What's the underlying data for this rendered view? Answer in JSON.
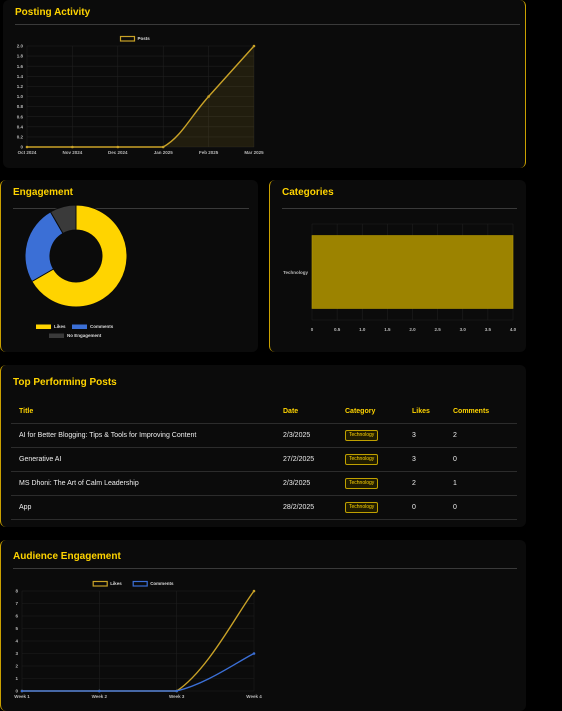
{
  "posting_activity": {
    "title": "Posting Activity"
  },
  "engagement": {
    "title": "Engagement"
  },
  "categories": {
    "title": "Categories"
  },
  "top_posts": {
    "title": "Top Performing Posts",
    "columns": [
      "Title",
      "Date",
      "Category",
      "Likes",
      "Comments"
    ],
    "rows": [
      {
        "title": "AI for Better Blogging: Tips & Tools for Improving Content",
        "date": "2/3/2025",
        "category": "Technology",
        "likes": "3",
        "comments": "2"
      },
      {
        "title": "Generative AI",
        "date": "27/2/2025",
        "category": "Technology",
        "likes": "3",
        "comments": "0"
      },
      {
        "title": "MS Dhoni: The Art of Calm Leadership",
        "date": "2/3/2025",
        "category": "Technology",
        "likes": "2",
        "comments": "1"
      },
      {
        "title": "App",
        "date": "28/2/2025",
        "category": "Technology",
        "likes": "0",
        "comments": "0"
      }
    ]
  },
  "audience": {
    "title": "Audience Engagement"
  },
  "colors": {
    "accent": "#ffd400",
    "gold": "#c9a227",
    "blue": "#3b6fd6",
    "card": "#0b0b0b",
    "bar": "#9c8300",
    "slice_none": "#3a3a3a"
  },
  "chart_data": [
    {
      "id": "posting",
      "type": "line",
      "series": [
        {
          "name": "Posts",
          "values": [
            0,
            0,
            0,
            0,
            1,
            2
          ]
        }
      ],
      "x": [
        "Oct 2024",
        "Nov 2024",
        "Dec 2024",
        "Jan 2025",
        "Feb 2025",
        "Mar 2025"
      ],
      "ylim": [
        0,
        2
      ],
      "yticks": [
        "0",
        "0.2",
        "0.4",
        "0.6",
        "0.8",
        "1.0",
        "1.2",
        "1.4",
        "1.6",
        "1.8",
        "2.0"
      ],
      "legend": "top",
      "grid": true,
      "fill": true
    },
    {
      "id": "engagement",
      "type": "pie",
      "labels": [
        "Likes",
        "Comments",
        "No Engagement"
      ],
      "values": [
        8,
        3,
        1
      ],
      "legend": "bottom"
    },
    {
      "id": "categories",
      "type": "bar",
      "orientation": "horizontal",
      "categories": [
        "Technology"
      ],
      "values": [
        4
      ],
      "xlim": [
        0,
        4
      ],
      "xticks": [
        "0",
        "0.5",
        "1.0",
        "1.5",
        "2.0",
        "2.5",
        "3.0",
        "3.5",
        "4.0"
      ],
      "grid": true
    },
    {
      "id": "audience",
      "type": "line",
      "x": [
        "Week 1",
        "Week 2",
        "Week 3",
        "Week 4"
      ],
      "series": [
        {
          "name": "Likes",
          "values": [
            0,
            0,
            0,
            8
          ]
        },
        {
          "name": "Comments",
          "values": [
            0,
            0,
            0,
            3
          ]
        }
      ],
      "ylim": [
        0,
        8
      ],
      "yticks": [
        "0",
        "1",
        "2",
        "3",
        "4",
        "5",
        "6",
        "7",
        "8"
      ],
      "legend": "top",
      "grid": true
    }
  ]
}
